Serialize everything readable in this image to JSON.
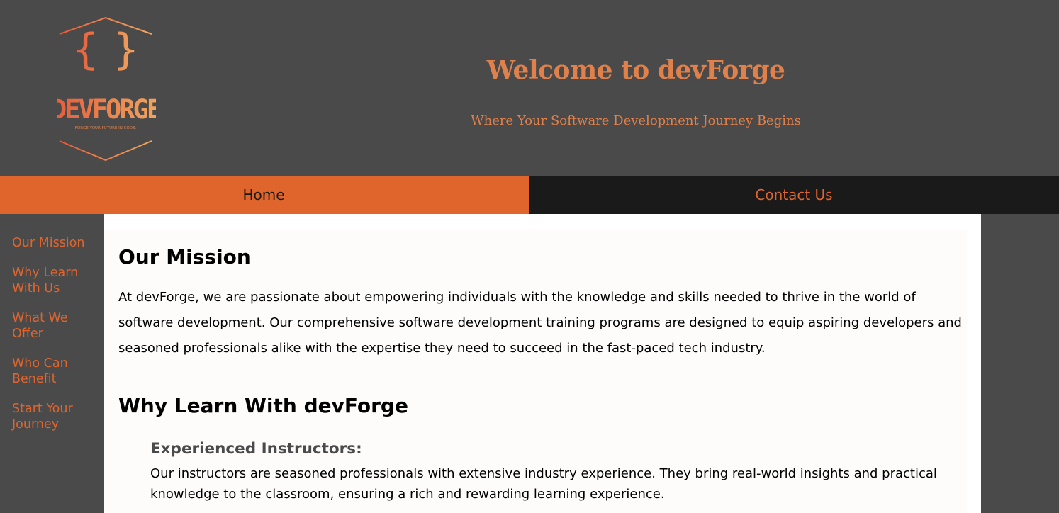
{
  "header": {
    "logo": {
      "brand": "DEVFORGE",
      "tagline": "FORGE YOUR FUTURE IN CODE."
    },
    "title": "Welcome to devForge",
    "subtitle": "Where Your Software Development Journey Begins"
  },
  "nav": {
    "home": "Home",
    "contact": "Contact Us"
  },
  "sidebar": {
    "items": [
      {
        "label": "Our Mission"
      },
      {
        "label": "Why Learn With Us"
      },
      {
        "label": "What We Offer"
      },
      {
        "label": "Who Can Benefit"
      },
      {
        "label": "Start Your Journey"
      }
    ]
  },
  "main": {
    "mission": {
      "heading": "Our Mission",
      "text": "At devForge, we are passionate about empowering individuals with the knowledge and skills needed to thrive in the world of software development. Our comprehensive software development training programs are designed to equip aspiring developers and seasoned professionals alike with the expertise they need to succeed in the fast-paced tech industry."
    },
    "why": {
      "heading": "Why Learn With devForge",
      "items": [
        {
          "title": "Experienced Instructors:",
          "text": "Our instructors are seasoned professionals with extensive industry experience. They bring real-world insights and practical knowledge to the classroom, ensuring a rich and rewarding learning experience."
        }
      ]
    }
  },
  "colors": {
    "accent": "#e0652d",
    "title": "#e0804a",
    "background": "#4a4a4a",
    "nav_dark": "#1a1a1a"
  }
}
